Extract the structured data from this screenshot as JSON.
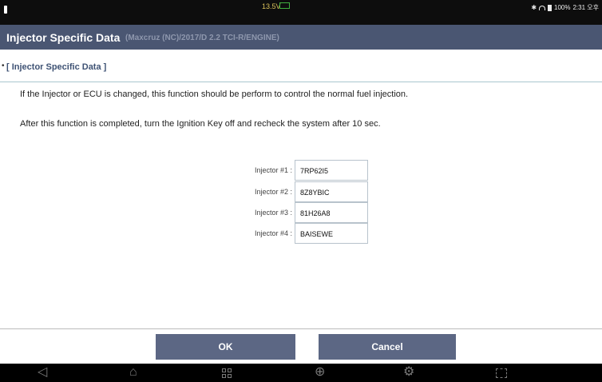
{
  "status_bar": {
    "voltage": "13.5V",
    "battery_percent": "100%",
    "time": "2:31 오후"
  },
  "header": {
    "title": "Injector Specific Data",
    "subtitle": "(Maxcruz (NC)/2017/D 2.2 TCI-R/ENGINE)"
  },
  "section": {
    "title": "[ Injector Specific Data ]"
  },
  "description": {
    "line1": "If the Injector or ECU is changed, this function should be perform to control the normal fuel injection.",
    "line2": "After this function is completed, turn the Ignition Key off and recheck the system after 10 sec."
  },
  "injectors": [
    {
      "label": "Injector #1 :",
      "value": "7RP62I5"
    },
    {
      "label": "Injector #2 :",
      "value": "8Z8YBIC"
    },
    {
      "label": "Injector #3 :",
      "value": "81H26A8"
    },
    {
      "label": "Injector #4 :",
      "value": "BAISEWE"
    }
  ],
  "buttons": {
    "ok": "OK",
    "cancel": "Cancel"
  },
  "nav_icons": [
    "back-icon",
    "home-icon",
    "recent-apps-icon",
    "globe-icon",
    "settings-icon",
    "screenshot-icon"
  ]
}
